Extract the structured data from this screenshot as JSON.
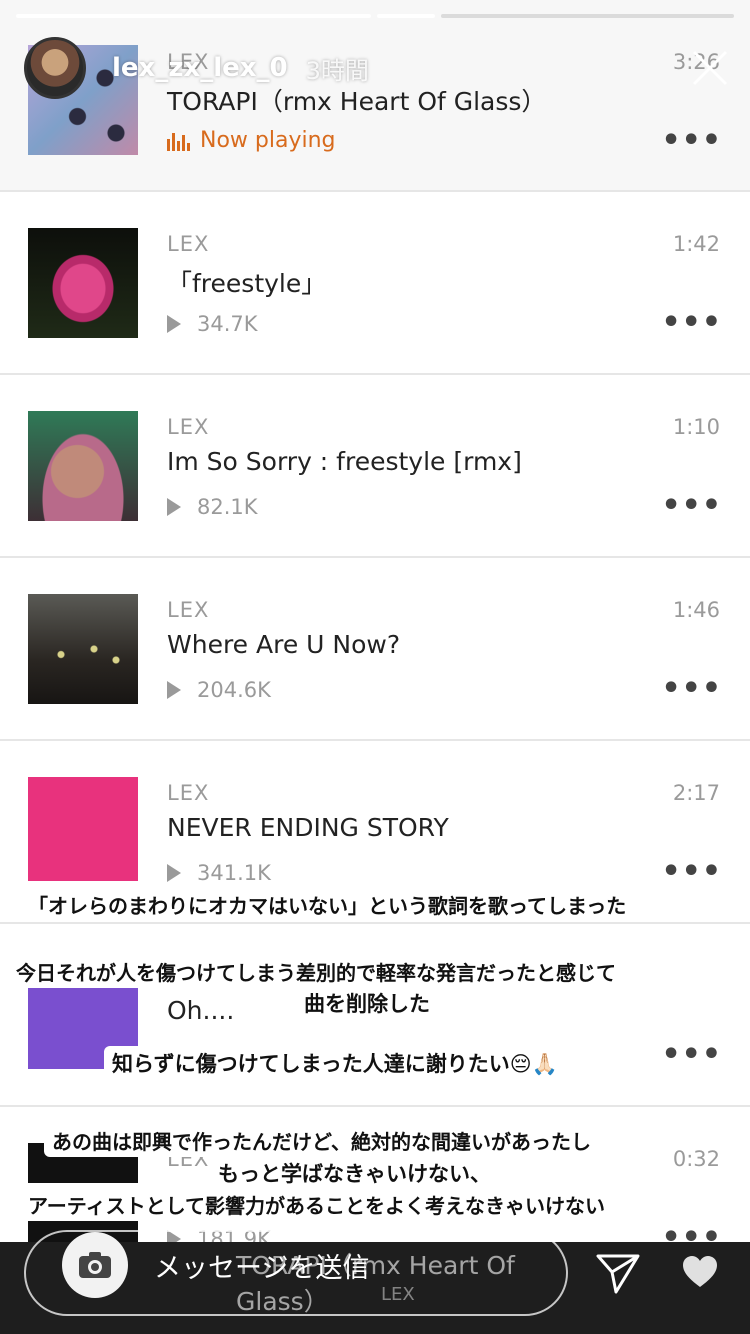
{
  "story": {
    "username": "lex_zx_lex_0",
    "time": "3時間",
    "message_placeholder": "メッセージを送信"
  },
  "tracks": [
    {
      "artist": "LEX",
      "title": "TORAPI（rmx Heart Of Glass）",
      "duration": "3:26",
      "status": "Now playing",
      "thumb_color": "#9a8fbf"
    },
    {
      "artist": "LEX",
      "title": "「freestyle」",
      "duration": "1:42",
      "plays": "34.7K",
      "thumb_color": "#1a1d16"
    },
    {
      "artist": "LEX",
      "title": "Im So Sorry : freestyle [rmx]",
      "duration": "1:10",
      "plays": "82.1K",
      "thumb_color": "#3b6b4f"
    },
    {
      "artist": "LEX",
      "title": "Where Are U Now?",
      "duration": "1:46",
      "plays": "204.6K",
      "thumb_color": "#3a3a3a"
    },
    {
      "artist": "LEX",
      "title": "NEVER ENDING STORY",
      "duration": "2:17",
      "plays": "341.1K",
      "thumb_color": "#e8327d"
    },
    {
      "title": "Oh....",
      "thumb_color": "#7a4fcf"
    },
    {
      "artist": "LEX",
      "duration": "0:32",
      "plays": "181.9K",
      "thumb_color": "#111111"
    }
  ],
  "overlay": {
    "line1": "「オレらのまわりにオカマはいない」という歌詞を歌ってしまった",
    "line2": "今日それが人を傷つけてしまう差別的で軽率な発言だったと感じて",
    "line3": "曲を削除した",
    "line4": "知らずに傷つけてしまった人達に謝りたい😔🙏🏻",
    "line5": "あの曲は即興で作ったんだけど、絶対的な間違いがあったし",
    "line6": "もっと学ばなきゃいけない、",
    "line7": "アーティストとして影響力があることをよく考えなきゃいけない"
  },
  "mini_player": {
    "title": "TORAPI（rmx Heart Of Glass）",
    "artist": "LEX"
  },
  "colors": {
    "accent": "#d86b1d",
    "bottom_bar": "#1e1e1e"
  },
  "icons": [
    "close-icon",
    "camera-icon",
    "send-icon",
    "heart-icon",
    "play-icon",
    "more-icon",
    "equalizer-icon"
  ]
}
